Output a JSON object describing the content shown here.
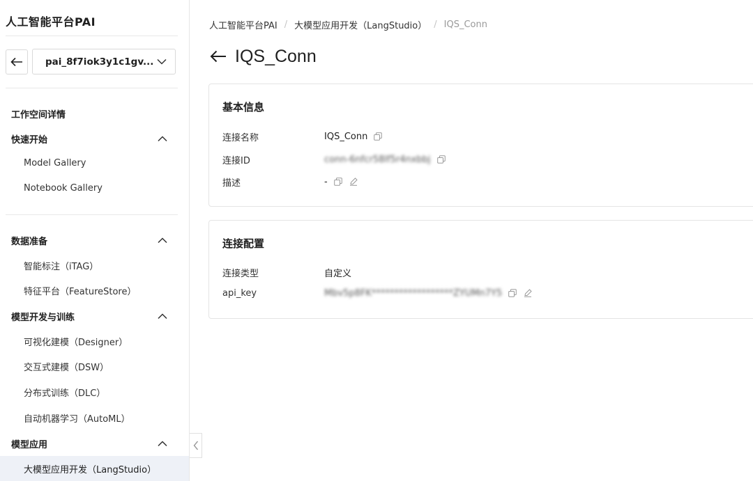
{
  "sidebar": {
    "app_title": "人工智能平台PAI",
    "workspace_value": "pai_8f7iok3y1c1gv...",
    "section_workspace": "工作空间详情",
    "groups": [
      {
        "label": "快速开始",
        "items": [
          "Model Gallery",
          "Notebook Gallery"
        ]
      },
      {
        "label": "数据准备",
        "items": [
          "智能标注（iTAG）",
          "特征平台（FeatureStore）"
        ]
      },
      {
        "label": "模型开发与训练",
        "items": [
          "可视化建模（Designer）",
          "交互式建模（DSW）",
          "分布式训练（DLC）",
          "自动机器学习（AutoML）"
        ]
      },
      {
        "label": "模型应用",
        "items": []
      }
    ],
    "active_item": "大模型应用开发（LangStudio）"
  },
  "breadcrumb": {
    "items": [
      "人工智能平台PAI",
      "大模型应用开发（LangStudio）"
    ],
    "current": "IQS_Conn",
    "separator": "/"
  },
  "page": {
    "title": "IQS_Conn"
  },
  "basic_info": {
    "title": "基本信息",
    "rows": [
      {
        "key": "连接名称",
        "value": "IQS_Conn"
      },
      {
        "key": "连接ID",
        "value": "conn-6nfcr58lf5r4nxbbj"
      },
      {
        "key": "描述",
        "value": "-"
      }
    ]
  },
  "conn_config": {
    "title": "连接配置",
    "rows": [
      {
        "key": "连接类型",
        "value": "自定义"
      },
      {
        "key": "api_key",
        "value": "Mbv5p8FK******************ZYUMn7Y5"
      }
    ]
  },
  "colors": {
    "border": "#e4e4e4",
    "active_bg": "#eef1f7",
    "muted": "#999999"
  }
}
